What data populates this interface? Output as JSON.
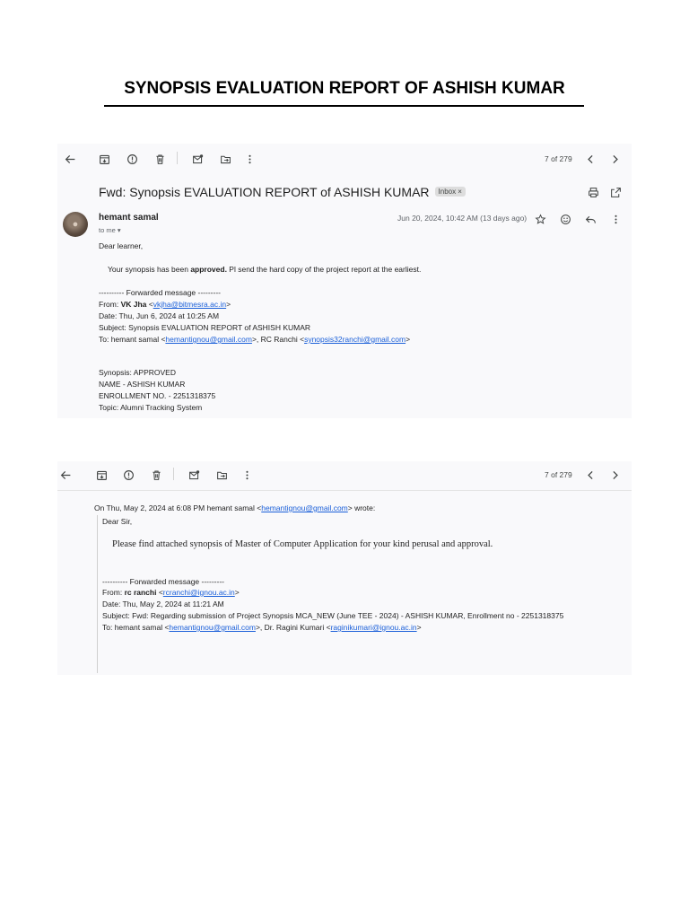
{
  "document": {
    "title": "SYNOPSIS EVALUATION REPORT OF ASHISH KUMAR"
  },
  "email1": {
    "pager": "7 of 279",
    "subject": "Fwd: Synopsis EVALUATION REPORT of ASHISH KUMAR",
    "label_chip": "Inbox ×",
    "sender": "hemant samal",
    "to_me": "to me ▾",
    "date": "Jun 20, 2024, 10:42 AM (13 days ago)",
    "greeting": "Dear learner,",
    "message_prefix": "Your synopsis has been ",
    "message_bold": "approved.",
    "message_suffix": " Pl send the hard copy of the project report at the earliest.",
    "fwd_header": "---------- Forwarded message ---------",
    "from_label": "From: ",
    "from_name": "VK Jha",
    "from_open": " <",
    "from_email": "vkjha@bitmesra.ac.in",
    "from_close": ">",
    "date_line": "Date: Thu, Jun 6, 2024 at 10:25 AM",
    "subject_line": "Subject: Synopsis EVALUATION REPORT of ASHISH KUMAR",
    "to_label": "To: hemant samal <",
    "to_email1": "hemantignou@gmail.com",
    "to_mid": ">, RC Ranchi <",
    "to_email2": "synopsis32ranchi@gmail.com",
    "to_close": ">",
    "synopsis_line": "Synopsis:   APPROVED",
    "name_line": "NAME -   ASHISH KUMAR",
    "enrollment_line": "ENROLLMENT NO. -  2251318375",
    "topic_line": "Topic: Alumni Tracking System"
  },
  "email2": {
    "pager": "7 of 279",
    "wrote_prefix": "On Thu, May 2, 2024 at 6:08 PM hemant samal <",
    "wrote_email": "hemantignou@gmail.com",
    "wrote_suffix": "> wrote:",
    "greeting": "Dear Sir,",
    "message": "Please find attached synopsis of Master of Computer Application  for your kind perusal and approval.",
    "fwd_header": "---------- Forwarded message ---------",
    "from_label": "From: ",
    "from_name": "rc ranchi",
    "from_open": " <",
    "from_email": "rcranchi@ignou.ac.in",
    "from_close": ">",
    "date_line": "Date: Thu, May 2, 2024 at 11:21 AM",
    "subject_line": "Subject: Fwd: Regarding submission of Project Synopsis MCA_NEW (June TEE - 2024) - ASHISH KUMAR, Enrollment no - 2251318375",
    "to_label": "To: hemant samal <",
    "to_email1": "hemantignou@gmail.com",
    "to_mid": ">, Dr. Ragini Kumari <",
    "to_email2": "raginikumari@ignou.ac.in",
    "to_close": ">"
  },
  "icons": [
    "back-arrow-icon",
    "archive-icon",
    "report-spam-icon",
    "delete-icon",
    "mark-unread-icon",
    "move-to-icon",
    "more-vert-icon",
    "chevron-left-icon",
    "chevron-right-icon",
    "print-icon",
    "open-new-window-icon",
    "star-icon",
    "emoji-icon",
    "reply-icon"
  ],
  "colors": {
    "link": "#1a5fd9",
    "shot_background": "#f9f9fb",
    "chip": "#dddddd"
  }
}
